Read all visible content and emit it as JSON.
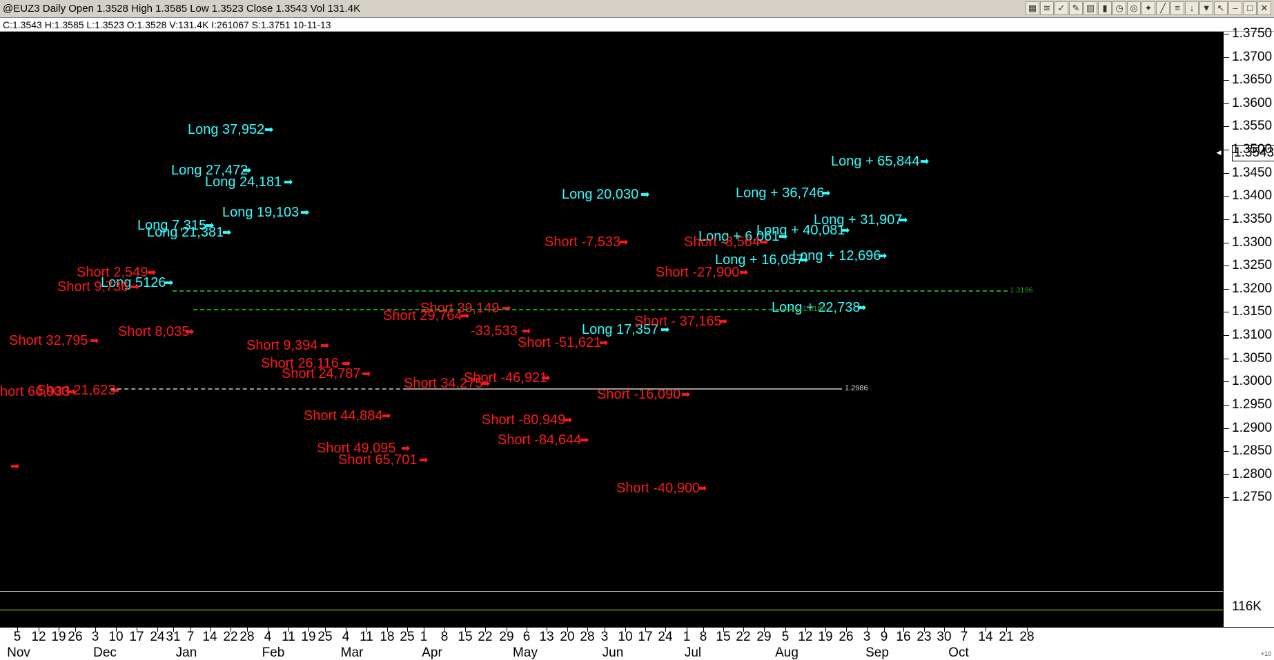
{
  "window": {
    "title": "@EUZ3 Daily Open 1.3528 High 1.3585 Low 1.3523 Close 1.3543 Vol 131.4K",
    "toolbar_icons": [
      "chart-type-icon",
      "indicator-icon",
      "drawing-icon",
      "pencil-icon",
      "bar-chart-icon",
      "tick-icon",
      "clock-icon",
      "target-icon",
      "pointer-icon",
      "trendline-icon",
      "fibonacci-icon",
      "arrow-down-icon",
      "trash-icon",
      "cursor-icon",
      "minimize-icon",
      "maximize-icon",
      "close-icon"
    ]
  },
  "info_bar": {
    "text": "C:1.3543  H:1.3585  L:1.3523  O:1.3528  V:131.4K  I:261067  S:1.3751  10-11-13"
  },
  "price_axis": {
    "labels": [
      "1.3750",
      "1.3700",
      "1.3650",
      "1.3600",
      "1.3550",
      "1.3500",
      "1.3450",
      "1.3400",
      "1.3350",
      "1.3300",
      "1.3250",
      "1.3200",
      "1.3150",
      "1.3100",
      "1.3050",
      "1.3000",
      "1.2950",
      "1.2900",
      "1.2850",
      "1.2800",
      "1.2750"
    ],
    "current_price": "1.3543",
    "volume_label": "116K"
  },
  "levels": [
    {
      "label": "1.3196",
      "color": "#1aa31a"
    },
    {
      "label": "1.3160",
      "color": "#1aa31a"
    },
    {
      "label": "1.2986",
      "color": "#999999"
    }
  ],
  "annotations": [
    {
      "text": "Long  37,952",
      "side": "long"
    },
    {
      "text": "Long 27,472",
      "side": "long"
    },
    {
      "text": "Long  24,181",
      "side": "long"
    },
    {
      "text": "Long  19,103",
      "side": "long"
    },
    {
      "text": "Long  7,315",
      "side": "long"
    },
    {
      "text": "Long  21,381",
      "side": "long"
    },
    {
      "text": "Long  5126",
      "side": "long"
    },
    {
      "text": "Long  20,030",
      "side": "long"
    },
    {
      "text": "Long + 36,746",
      "side": "long"
    },
    {
      "text": "Long  + 65,844",
      "side": "long"
    },
    {
      "text": "Long + 31,907",
      "side": "long"
    },
    {
      "text": "Long + 40,081",
      "side": "long"
    },
    {
      "text": "Long + 6,061",
      "side": "long"
    },
    {
      "text": "Long + 16,057",
      "side": "long"
    },
    {
      "text": "Long + 12,696",
      "side": "long"
    },
    {
      "text": "Long + 22,738",
      "side": "long"
    },
    {
      "text": "Long  17,357",
      "side": "long"
    },
    {
      "text": "Short  2,549",
      "side": "short"
    },
    {
      "text": "Short  9,736",
      "side": "short"
    },
    {
      "text": "Short  32,795",
      "side": "short"
    },
    {
      "text": "Short 8,035",
      "side": "short"
    },
    {
      "text": "Short  9,394",
      "side": "short"
    },
    {
      "text": "Short  26,116",
      "side": "short"
    },
    {
      "text": "Short  24,787",
      "side": "short"
    },
    {
      "text": "Short 21,623",
      "side": "short"
    },
    {
      "text": "hort 66,933",
      "side": "short"
    },
    {
      "text": "Short  44,884",
      "side": "short"
    },
    {
      "text": "Short   49,095",
      "side": "short"
    },
    {
      "text": "Short  65,701",
      "side": "short"
    },
    {
      "text": "Short  39,149",
      "side": "short"
    },
    {
      "text": "Short  29,764",
      "side": "short"
    },
    {
      "text": "-33,533",
      "side": "short"
    },
    {
      "text": "Short  34,275",
      "side": "short"
    },
    {
      "text": "Short -46,921",
      "side": "short"
    },
    {
      "text": "Short  -51,621",
      "side": "short"
    },
    {
      "text": "Short  -80,949",
      "side": "short"
    },
    {
      "text": "Short  -84,644",
      "side": "short"
    },
    {
      "text": "Short  -7,533",
      "side": "short"
    },
    {
      "text": "Short  -16,090",
      "side": "short"
    },
    {
      "text": "Short  -40,900",
      "side": "short"
    },
    {
      "text": "Short  - 37,165",
      "side": "short"
    },
    {
      "text": "Short  -27,900",
      "side": "short"
    },
    {
      "text": "Short  -8,564",
      "side": "short"
    },
    {
      "text": "",
      "side": "short"
    }
  ],
  "time_axis": {
    "days": [
      "5",
      "12",
      "19",
      "26",
      "3",
      "10",
      "17",
      "24",
      "31",
      "7",
      "14",
      "22",
      "28",
      "4",
      "11",
      "19",
      "25",
      "4",
      "11",
      "18",
      "25",
      "1",
      "8",
      "15",
      "22",
      "29",
      "6",
      "13",
      "20",
      "28",
      "3",
      "10",
      "17",
      "24",
      "1",
      "8",
      "15",
      "22",
      "29",
      "5",
      "12",
      "19",
      "26",
      "3",
      "9",
      "16",
      "23",
      "30",
      "7",
      "14",
      "21",
      "28"
    ],
    "months": [
      "Nov",
      "Dec",
      "Jan",
      "Feb",
      "Mar",
      "Apr",
      "May",
      "Jun",
      "Jul",
      "Aug",
      "Sep",
      "Oct"
    ]
  }
}
